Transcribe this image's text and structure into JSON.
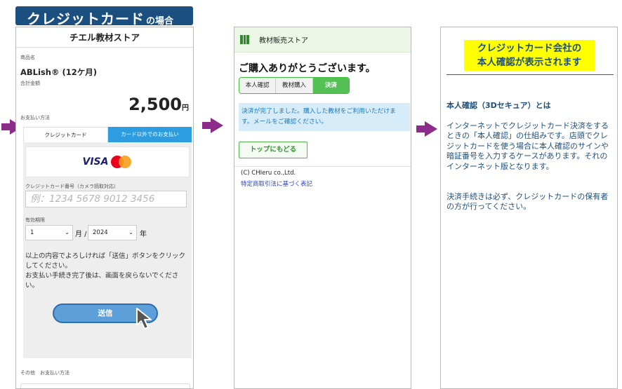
{
  "header_tag": {
    "main": "クレジットカード",
    "suffix": "の場合"
  },
  "panel1": {
    "store_title": "チエル教材ストア",
    "product_label": "商品名",
    "product_name": "ABLish® (12ケ月)",
    "total_label": "合計金額",
    "price": "2,500",
    "price_unit": "円",
    "payment_method_label": "お支払い方法",
    "tab_card": "クレジットカード",
    "tab_other": "カード以外でのお支払い",
    "card_brands": [
      "VISA",
      "Mastercard"
    ],
    "card_number_label": "クレジットカード番号（カメラ読取対応）",
    "card_number_placeholder": "例：1234 5678 9012 3456",
    "expiry_label": "有効期限",
    "expiry_month": "1",
    "expiry_month_unit": "月 /",
    "expiry_year": "2024",
    "expiry_year_unit": "年",
    "note": "以上の内容でよろしければ「送信」ボタンをクリックしてください。\nお支払い手続き完了後は、画面を戻らないでください。",
    "submit_label": "送信",
    "other_label": "その他　お支払い方法"
  },
  "panel2": {
    "store_name": "教材販売ストア",
    "thanks": "ご購入ありがとうございます。",
    "steps": [
      "本人確認",
      "教材購入",
      "決済"
    ],
    "active_step": "決済",
    "completion_message": "決済が完了しました。購入した教材をご利用いただけます。メールをご確認ください。",
    "top_button": "トップにもどる",
    "copyright": "(C) CHIeru co.,Ltd.",
    "law_link": "特定商取引法に基づく表記"
  },
  "panel3": {
    "highlight_line1": "クレジットカード会社の",
    "highlight_line2": "本人確認が表示されます",
    "heading": "本人確認（3Dセキュア）とは",
    "body": "インターネットでクレジットカード決済をするときの「本人確認」の仕組みです。店頭でクレジットカードを使う場合に本人確認のサインや暗証番号を入力するケースがあります。それのインターネット版となります。",
    "body2": "決済手続きは必ず、クレジットカードの保有者の方が行ってください。"
  },
  "colors": {
    "header_tag": "#1a4f80",
    "arrow": "#8b2b8a",
    "tab_active": "#2d9de0",
    "submit": "#5d9fd8",
    "step_active": "#55c055",
    "highlight": "#ffff00",
    "panel3_text": "#1f4f7c"
  }
}
